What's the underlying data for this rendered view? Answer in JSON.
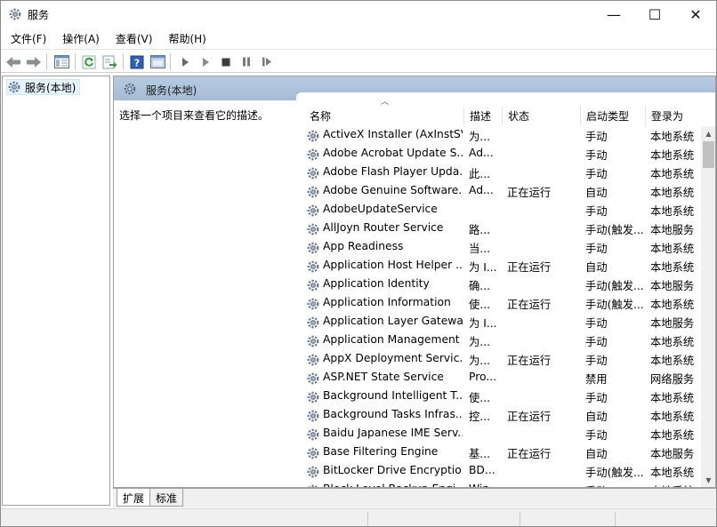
{
  "window": {
    "title": "服务"
  },
  "titlebar": {
    "minimize": "—",
    "maximize": "☐",
    "close": "✕"
  },
  "menu": [
    {
      "label": "文件(F)"
    },
    {
      "label": "操作(A)"
    },
    {
      "label": "查看(V)"
    },
    {
      "label": "帮助(H)"
    }
  ],
  "tree": {
    "root_label": "服务(本地)"
  },
  "pane": {
    "header": "服务(本地)",
    "description_hint": "选择一个项目来查看它的描述。"
  },
  "columns": {
    "name": "名称",
    "desc": "描述",
    "status": "状态",
    "start": "启动类型",
    "logon": "登录为"
  },
  "services": [
    {
      "name": "ActiveX Installer (AxInstSV)",
      "desc": "为...",
      "status": "",
      "start": "手动",
      "logon": "本地系统"
    },
    {
      "name": "Adobe Acrobat Update S...",
      "desc": "Ad...",
      "status": "",
      "start": "手动",
      "logon": "本地系统"
    },
    {
      "name": "Adobe Flash Player Upda...",
      "desc": "此...",
      "status": "",
      "start": "手动",
      "logon": "本地系统"
    },
    {
      "name": "Adobe Genuine Software...",
      "desc": "Ad...",
      "status": "正在运行",
      "start": "自动",
      "logon": "本地系统"
    },
    {
      "name": "AdobeUpdateService",
      "desc": "",
      "status": "",
      "start": "手动",
      "logon": "本地系统"
    },
    {
      "name": "AllJoyn Router Service",
      "desc": "路...",
      "status": "",
      "start": "手动(触发...",
      "logon": "本地服务"
    },
    {
      "name": "App Readiness",
      "desc": "当...",
      "status": "",
      "start": "手动",
      "logon": "本地系统"
    },
    {
      "name": "Application Host Helper ...",
      "desc": "为 I...",
      "status": "正在运行",
      "start": "自动",
      "logon": "本地系统"
    },
    {
      "name": "Application Identity",
      "desc": "确...",
      "status": "",
      "start": "手动(触发...",
      "logon": "本地服务"
    },
    {
      "name": "Application Information",
      "desc": "使...",
      "status": "正在运行",
      "start": "手动(触发...",
      "logon": "本地系统"
    },
    {
      "name": "Application Layer Gatewa...",
      "desc": "为 I...",
      "status": "",
      "start": "手动",
      "logon": "本地服务"
    },
    {
      "name": "Application Management",
      "desc": "为...",
      "status": "",
      "start": "手动",
      "logon": "本地系统"
    },
    {
      "name": "AppX Deployment Servic...",
      "desc": "为...",
      "status": "正在运行",
      "start": "手动",
      "logon": "本地系统"
    },
    {
      "name": "ASP.NET State Service",
      "desc": "Pro...",
      "status": "",
      "start": "禁用",
      "logon": "网络服务"
    },
    {
      "name": "Background Intelligent T...",
      "desc": "使...",
      "status": "",
      "start": "手动",
      "logon": "本地系统"
    },
    {
      "name": "Background Tasks Infras...",
      "desc": "控...",
      "status": "正在运行",
      "start": "自动",
      "logon": "本地系统"
    },
    {
      "name": "Baidu Japanese IME Serv...",
      "desc": "",
      "status": "",
      "start": "手动",
      "logon": "本地系统"
    },
    {
      "name": "Base Filtering Engine",
      "desc": "基...",
      "status": "正在运行",
      "start": "自动",
      "logon": "本地服务"
    },
    {
      "name": "BitLocker Drive Encryptio...",
      "desc": "BD...",
      "status": "",
      "start": "手动(触发...",
      "logon": "本地系统"
    },
    {
      "name": "Block Level Backup Engi...",
      "desc": "Win...",
      "status": "",
      "start": "手动",
      "logon": "本地系统"
    }
  ],
  "tabs": {
    "extended": "扩展",
    "standard": "标准"
  },
  "icons": {
    "gear": "gear-icon",
    "back": "back-arrow-icon",
    "forward": "forward-arrow-icon",
    "colors": {
      "header_bg": "#aec4da",
      "selection": "#e5f3ff"
    }
  }
}
